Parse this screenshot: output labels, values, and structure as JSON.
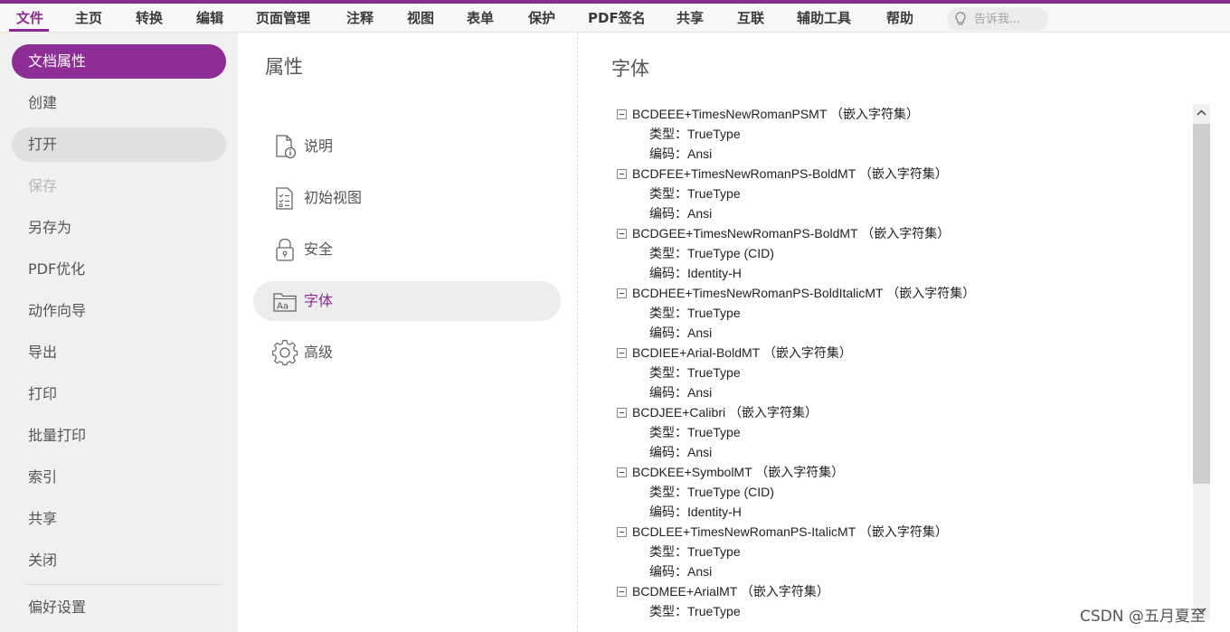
{
  "menu": {
    "items": [
      {
        "label": "文件"
      },
      {
        "label": "主页"
      },
      {
        "label": "转换"
      },
      {
        "label": "编辑"
      },
      {
        "label": "页面管理"
      },
      {
        "label": "注释"
      },
      {
        "label": "视图"
      },
      {
        "label": "表单"
      },
      {
        "label": "保护"
      },
      {
        "label": "PDF签名"
      },
      {
        "label": "共享"
      },
      {
        "label": "互联"
      },
      {
        "label": "辅助工具"
      },
      {
        "label": "帮助"
      }
    ],
    "active_color": "#8b2a93",
    "tellme_placeholder": "告诉我..."
  },
  "sidebar": {
    "items": [
      {
        "label": "文档属性",
        "state": "active"
      },
      {
        "label": "创建",
        "state": "normal"
      },
      {
        "label": "打开",
        "state": "hover"
      },
      {
        "label": "保存",
        "state": "disabled"
      },
      {
        "label": "另存为",
        "state": "normal"
      },
      {
        "label": "PDF优化",
        "state": "normal"
      },
      {
        "label": "动作向导",
        "state": "normal"
      },
      {
        "label": "导出",
        "state": "normal"
      },
      {
        "label": "打印",
        "state": "normal"
      },
      {
        "label": "批量打印",
        "state": "normal"
      },
      {
        "label": "索引",
        "state": "normal"
      },
      {
        "label": "共享",
        "state": "normal"
      },
      {
        "label": "关闭",
        "state": "normal"
      },
      {
        "label": "偏好设置",
        "state": "normal"
      }
    ]
  },
  "properties": {
    "title": "属性",
    "items": [
      {
        "label": "说明",
        "icon": "document-info-icon"
      },
      {
        "label": "初始视图",
        "icon": "checklist-icon"
      },
      {
        "label": "安全",
        "icon": "lock-icon"
      },
      {
        "label": "字体",
        "icon": "font-folder-icon",
        "active": true
      },
      {
        "label": "高级",
        "icon": "gear-icon"
      }
    ]
  },
  "content": {
    "title": "字体",
    "type_label": "类型：",
    "encoding_label": "编码：",
    "fonts": [
      {
        "name": "BCDEEE+TimesNewRomanPSMT （嵌入字符集）",
        "type": "TrueType",
        "encoding": "Ansi"
      },
      {
        "name": "BCDFEE+TimesNewRomanPS-BoldMT （嵌入字符集）",
        "type": "TrueType",
        "encoding": "Ansi"
      },
      {
        "name": "BCDGEE+TimesNewRomanPS-BoldMT （嵌入字符集）",
        "type": "TrueType (CID)",
        "encoding": "Identity-H"
      },
      {
        "name": "BCDHEE+TimesNewRomanPS-BoldItalicMT （嵌入字符集）",
        "type": "TrueType",
        "encoding": "Ansi"
      },
      {
        "name": "BCDIEE+Arial-BoldMT （嵌入字符集）",
        "type": "TrueType",
        "encoding": "Ansi"
      },
      {
        "name": "BCDJEE+Calibri （嵌入字符集）",
        "type": "TrueType",
        "encoding": "Ansi"
      },
      {
        "name": "BCDKEE+SymbolMT （嵌入字符集）",
        "type": "TrueType (CID)",
        "encoding": "Identity-H"
      },
      {
        "name": "BCDLEE+TimesNewRomanPS-ItalicMT （嵌入字符集）",
        "type": "TrueType",
        "encoding": "Ansi"
      },
      {
        "name": "BCDMEE+ArialMT （嵌入字符集）",
        "type": "TrueType",
        "encoding": ""
      }
    ]
  },
  "watermark": "CSDN @五月夏至"
}
